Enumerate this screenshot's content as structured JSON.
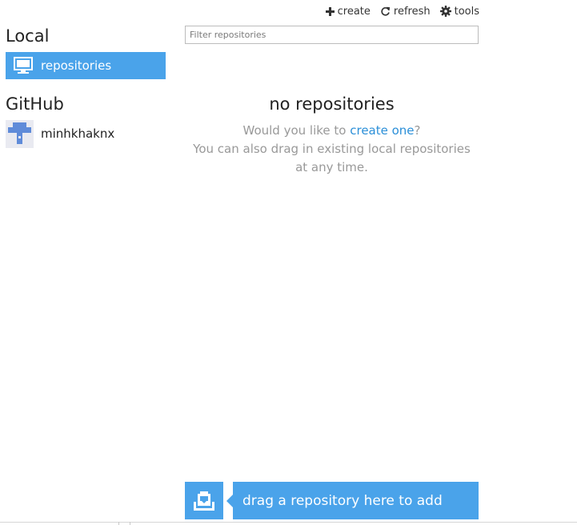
{
  "toolbar": {
    "create_label": "create",
    "refresh_label": "refresh",
    "tools_label": "tools"
  },
  "sidebar": {
    "local_heading": "Local",
    "local_items": [
      {
        "label": "repositories",
        "icon": "monitor-icon",
        "selected": true
      }
    ],
    "github_heading": "GitHub",
    "github_accounts": [
      {
        "label": "minhkhaknx",
        "icon": "identicon-avatar"
      }
    ]
  },
  "filter": {
    "placeholder": "Filter repositories",
    "value": ""
  },
  "empty_state": {
    "title": "no repositories",
    "line1_prefix": "Would you like to ",
    "line1_link": "create one",
    "line1_suffix": "?",
    "line2": "You can also drag in existing local repositories",
    "line3": "at any time."
  },
  "drop_zone": {
    "label": "drag a repository here to add",
    "icon": "clipboard-download-icon"
  },
  "colors": {
    "accent": "#4aa3ea",
    "link": "#2b8fd8",
    "muted_text": "#999999",
    "avatar_blue": "#5f8bd9"
  }
}
